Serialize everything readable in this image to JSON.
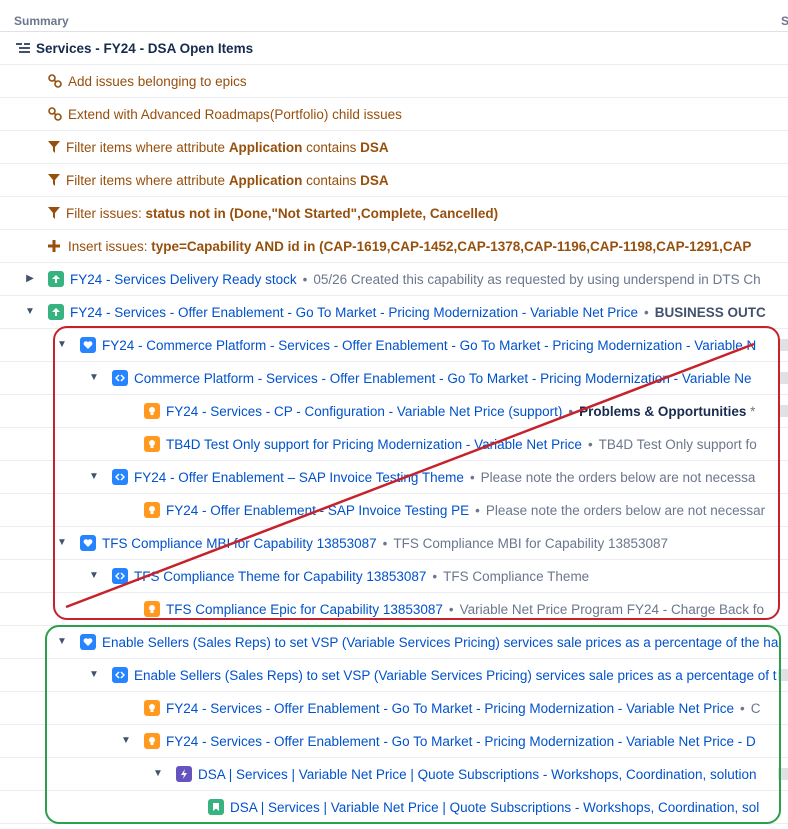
{
  "header": {
    "summary": "Summary",
    "next_col": "S"
  },
  "root": {
    "label": "Services - FY24 - DSA Open Items"
  },
  "rules": [
    {
      "icon": "link-icon",
      "text": "Add issues belonging to epics"
    },
    {
      "icon": "link-icon",
      "text": "Extend with Advanced Roadmaps(Portfolio) child issues"
    },
    {
      "icon": "filter-icon",
      "pre": "Filter items where attribute ",
      "attr": "Application",
      "mid": " contains ",
      "val": "DSA"
    },
    {
      "icon": "filter-icon",
      "pre": "Filter items where attribute ",
      "attr": "Application",
      "mid": " contains ",
      "val": "DSA"
    },
    {
      "icon": "filter-icon",
      "pre": "Filter issues: ",
      "attr": "status not in (Done,\"Not Started\",Complete, Cancelled)",
      "mid": "",
      "val": ""
    },
    {
      "icon": "plus-icon",
      "pre": "Insert issues: ",
      "attr": "type=Capability AND id in (CAP-1619,CAP-1452,CAP-1378,CAP-1196,CAP-1198,CAP-1291,CAP",
      "mid": "",
      "val": ""
    }
  ],
  "issues": [
    {
      "type": "capability",
      "title": "FY24 - Services Delivery Ready stock",
      "desc": "05/26 Created this capability as requested by using underspend in DTS Ch",
      "bold": ""
    },
    {
      "type": "capability",
      "title": "FY24 - Services - Offer Enablement - Go To Market - Pricing Modernization - Variable Net Price",
      "desc": "",
      "bold": "BUSINESS OUTC"
    },
    {
      "type": "initiative",
      "title": "FY24 - Commerce Platform - Services - Offer Enablement - Go To Market - Pricing Modernization - Variable N",
      "desc": "",
      "bold": ""
    },
    {
      "type": "theme",
      "title": "Commerce Platform - Services - Offer Enablement - Go To Market - Pricing Modernization - Variable Ne",
      "desc": "",
      "bold": ""
    },
    {
      "type": "epic",
      "title": "FY24 - Services - CP - Configuration - Variable Net Price (support)",
      "desc": "",
      "bold": "Problems & Opportunities",
      "tail": " *"
    },
    {
      "type": "epic",
      "title": "TB4D Test Only support for Pricing Modernization - Variable Net Price",
      "desc": "TB4D Test Only support fo",
      "bold": ""
    },
    {
      "type": "theme",
      "title": "FY24 - Offer Enablement – SAP Invoice Testing Theme",
      "desc": "  Please note the orders below are not necessa",
      "bold": ""
    },
    {
      "type": "epic",
      "title": "FY24 - Offer Enablement - SAP Invoice Testing PE",
      "desc": "Please note the orders below are not necessar",
      "bold": ""
    },
    {
      "type": "initiative",
      "title": "TFS Compliance MBI for Capability 13853087",
      "desc": "TFS Compliance MBI for Capability 13853087",
      "bold": ""
    },
    {
      "type": "theme",
      "title": "TFS Compliance Theme for Capability 13853087",
      "desc": "TFS Compliance Theme",
      "bold": ""
    },
    {
      "type": "epic",
      "title": "TFS Compliance Epic for Capability 13853087",
      "desc": "Variable Net Price Program FY24 - Charge Back fo",
      "bold": ""
    },
    {
      "type": "initiative",
      "title": "Enable Sellers (Sales Reps) to set VSP (Variable Services Pricing) services sale prices as a percentage of the ha",
      "desc": "",
      "bold": ""
    },
    {
      "type": "theme",
      "title": "Enable Sellers (Sales Reps) to set VSP (Variable Services Pricing) services sale prices as a percentage of t",
      "desc": "",
      "bold": ""
    },
    {
      "type": "epic",
      "title": "FY24 - Services - Offer Enablement - Go To Market - Pricing Modernization - Variable Net Price",
      "desc": "C",
      "bold": ""
    },
    {
      "type": "epic",
      "title": "FY24 - Services - Offer Enablement - Go To Market - Pricing Modernization - Variable Net Price - D",
      "desc": "",
      "bold": ""
    },
    {
      "type": "subtask",
      "title": "DSA | Services | Variable Net Price | Quote Subscriptions - Workshops, Coordination, solution",
      "desc": "",
      "bold": ""
    },
    {
      "type": "story",
      "title": "DSA | Services | Variable Net Price | Quote Subscriptions - Workshops, Coordination, sol",
      "desc": "",
      "bold": ""
    }
  ],
  "colors": {
    "rule": "#974f0c",
    "link": "#0052cc",
    "capability": "#36b37e",
    "initiative": "#2684ff",
    "theme": "#2684ff",
    "epic": "#ff991f",
    "subtask": "#6554c0",
    "story": "#36b37e",
    "red_box": "#c6222b",
    "green_box": "#2ba04a"
  }
}
